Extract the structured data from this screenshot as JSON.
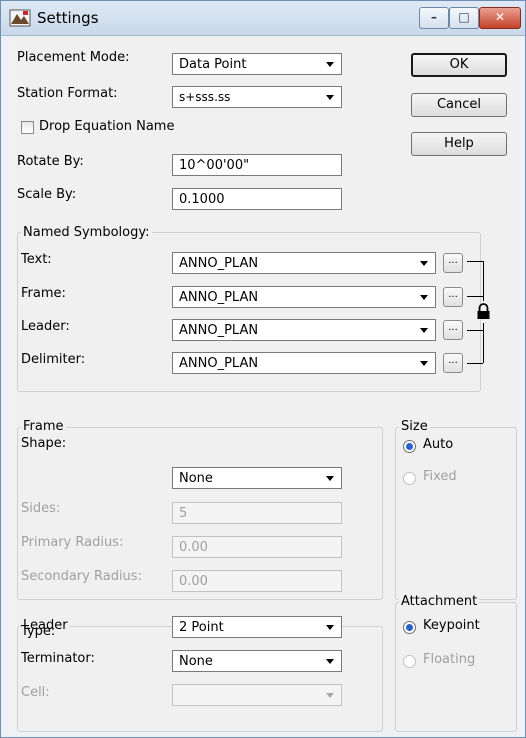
{
  "window": {
    "title": "Settings",
    "icon": "app-icon"
  },
  "placement_mode": {
    "label": "Placement Mode:",
    "value": "Data Point"
  },
  "station_format": {
    "label": "Station Format:",
    "value": "s+sss.ss"
  },
  "drop_equation": {
    "label": "Drop Equation Name",
    "checked": false
  },
  "rotate_by": {
    "label": "Rotate By:",
    "value": "10^00'00\""
  },
  "scale_by": {
    "label": "Scale By:",
    "value": "0.1000"
  },
  "buttons": {
    "ok": "OK",
    "cancel": "Cancel",
    "help": "Help"
  },
  "named_symbology": {
    "title": "Named Symbology:",
    "rows": [
      {
        "label": "Text:",
        "value": "ANNO_PLAN",
        "more": "..."
      },
      {
        "label": "Frame:",
        "value": "ANNO_PLAN",
        "more": "..."
      },
      {
        "label": "Leader:",
        "value": "ANNO_PLAN",
        "more": "..."
      },
      {
        "label": "Delimiter:",
        "value": "ANNO_PLAN",
        "more": "..."
      }
    ]
  },
  "frame": {
    "title": "Frame",
    "shape": {
      "label": "Shape:",
      "value": "None"
    },
    "sides": {
      "label": "Sides:",
      "value": "5"
    },
    "primary_radius": {
      "label": "Primary Radius:",
      "value": "0.00"
    },
    "secondary_radius": {
      "label": "Secondary Radius:",
      "value": "0.00"
    }
  },
  "size": {
    "title": "Size",
    "options": [
      "Auto",
      "Fixed"
    ],
    "selected": "Auto"
  },
  "leader": {
    "title": "Leader",
    "type": {
      "label": "Type:",
      "value": "2 Point"
    },
    "terminator": {
      "label": "Terminator:",
      "value": "None"
    },
    "cell": {
      "label": "Cell:",
      "value": ""
    }
  },
  "attachment": {
    "title": "Attachment",
    "options": [
      "Keypoint",
      "Floating"
    ],
    "selected": "Keypoint"
  },
  "colors": {
    "accent_radio": "#2a62c9",
    "close_button": "#c4422a",
    "title_bar": "#c8d8ea"
  }
}
